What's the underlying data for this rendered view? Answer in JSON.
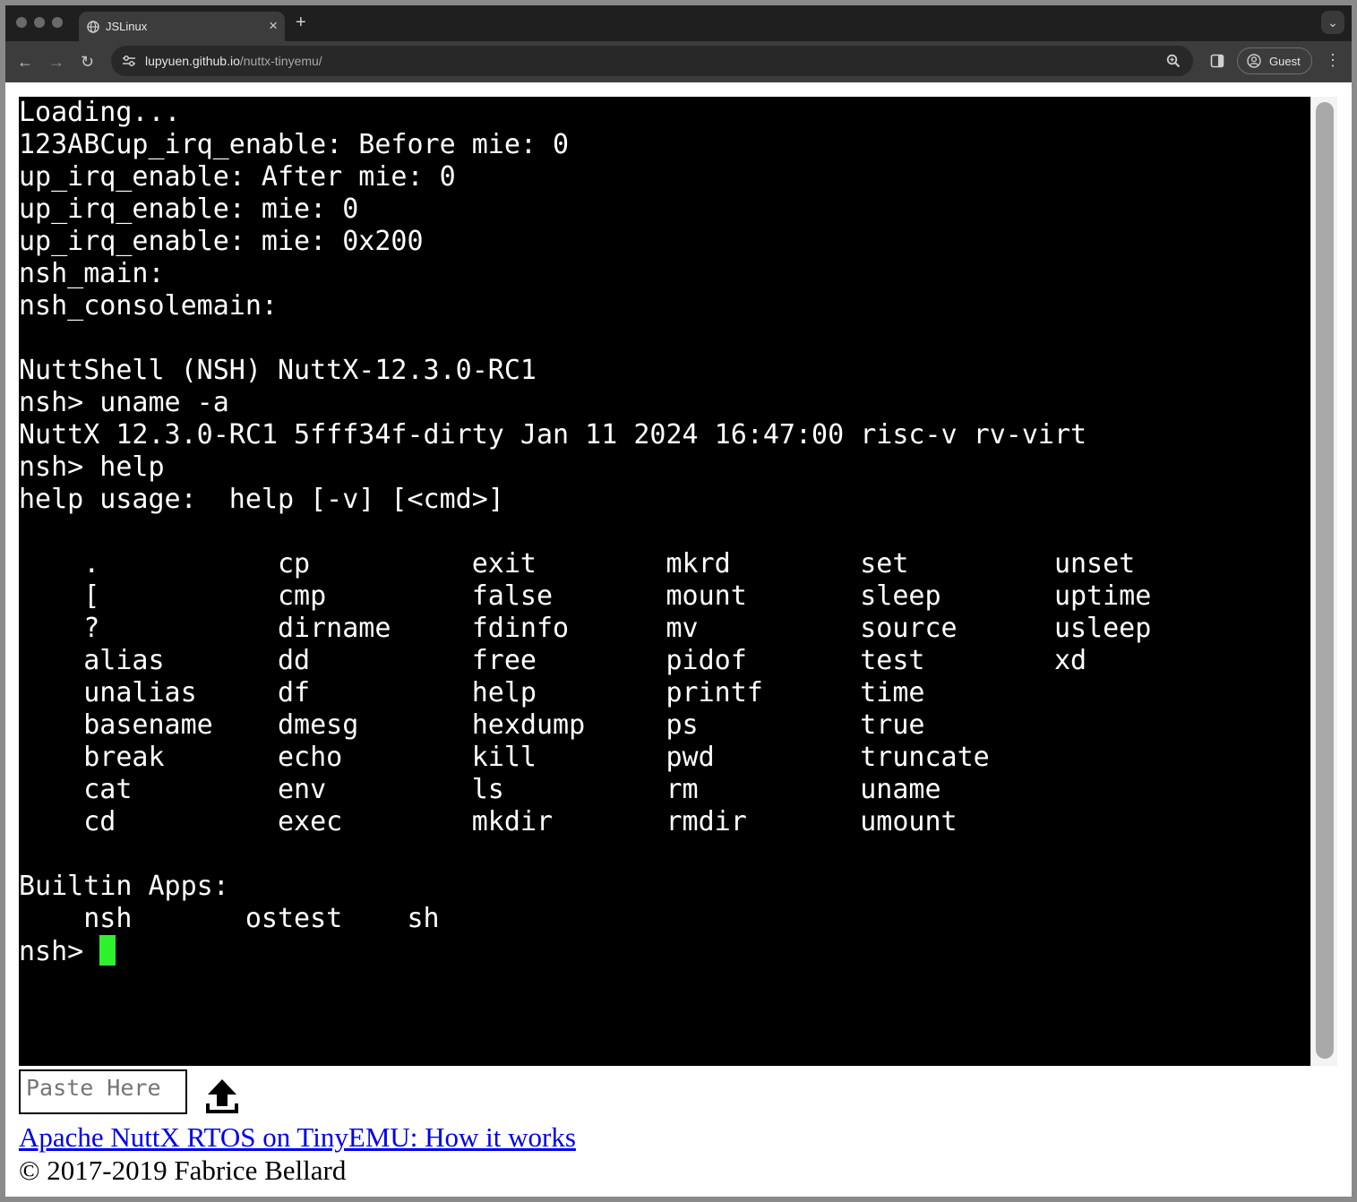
{
  "browser": {
    "tab_title": "JSLinux",
    "tab_close": "×",
    "new_tab": "+",
    "tab_menu": "⌄",
    "back": "←",
    "forward": "→",
    "reload": "↻",
    "url_host": "lupyuen.github.io",
    "url_path": "/nuttx-tinyemu/",
    "profile_label": "Guest",
    "menu": "⋮"
  },
  "terminal": {
    "lines": [
      "Loading...",
      "123ABCup_irq_enable: Before mie: 0",
      "up_irq_enable: After mie: 0",
      "up_irq_enable: mie: 0",
      "up_irq_enable: mie: 0x200",
      "nsh_main:",
      "nsh_consolemain:",
      "",
      "NuttShell (NSH) NuttX-12.3.0-RC1",
      "nsh> uname -a",
      "NuttX 12.3.0-RC1 5fff34f-dirty Jan 11 2024 16:47:00 risc-v rv-virt",
      "nsh> help",
      "help usage:  help [-v] [<cmd>]",
      "",
      "    .           cp          exit        mkrd        set         unset",
      "    [           cmp         false       mount       sleep       uptime",
      "    ?           dirname     fdinfo      mv          source      usleep",
      "    alias       dd          free        pidof       test        xd",
      "    unalias     df          help        printf      time",
      "    basename    dmesg       hexdump     ps          true",
      "    break       echo        kill        pwd         truncate",
      "    cat         env         ls          rm          uname",
      "    cd          exec        mkdir       rmdir       umount",
      "",
      "Builtin Apps:",
      "    nsh       ostest    sh"
    ],
    "prompt": "nsh>"
  },
  "paste": {
    "placeholder": "Paste Here"
  },
  "footer": {
    "link_text": "Apache NuttX RTOS on TinyEMU: How it works",
    "copyright": "© 2017-2019 Fabrice Bellard"
  },
  "colors": {
    "terminal_bg": "#000000",
    "terminal_fg": "#ffffff",
    "cursor": "#2ef12e",
    "link": "#0000ee"
  }
}
